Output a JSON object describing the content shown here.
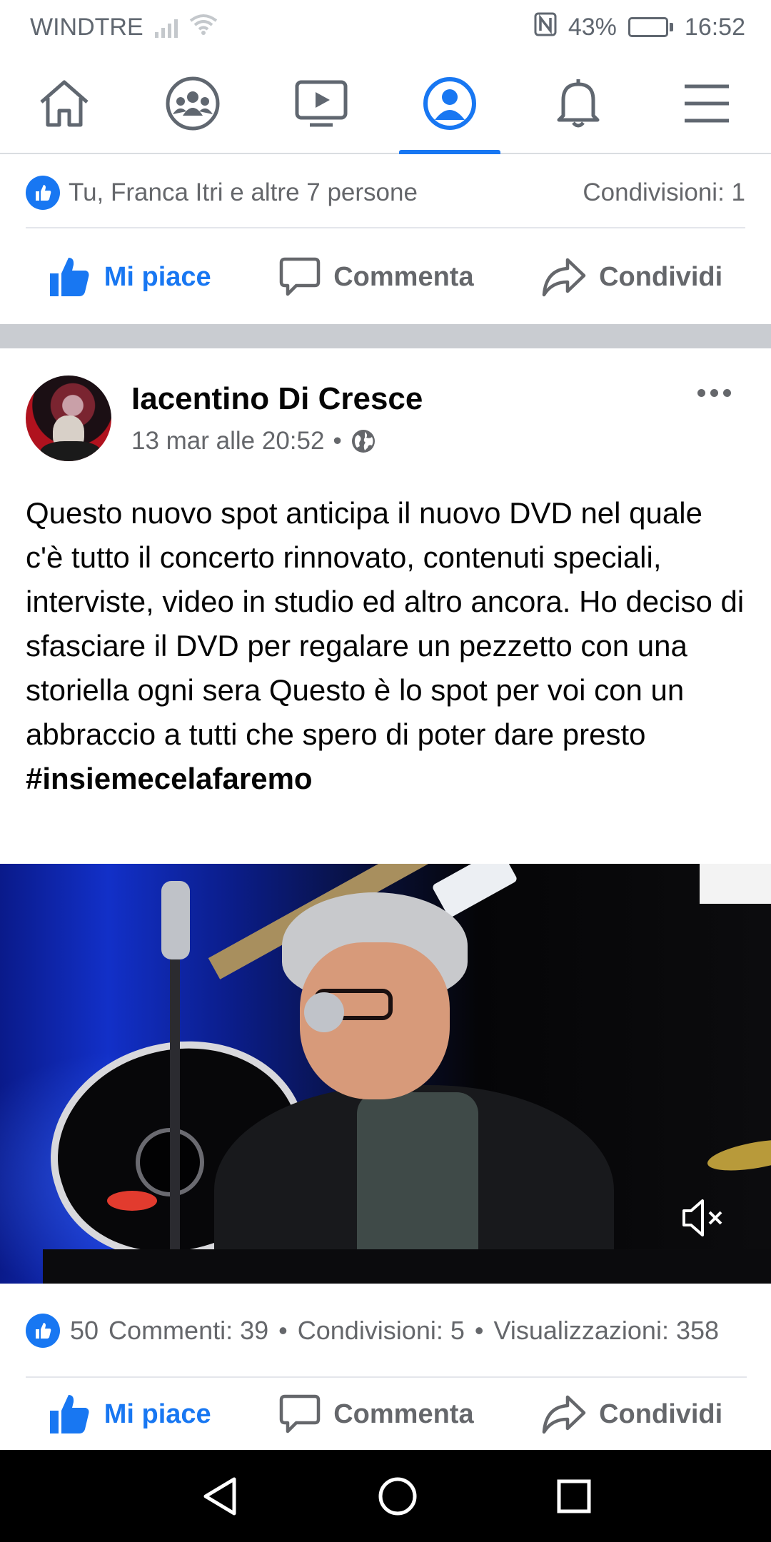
{
  "status_bar": {
    "carrier": "WINDTRE",
    "battery_percent": "43%",
    "battery_level": 0.43,
    "time": "16:52"
  },
  "nav": {
    "active": "profile",
    "items": [
      "home",
      "groups",
      "watch",
      "profile",
      "notifications",
      "menu"
    ]
  },
  "previous_post": {
    "reactions_text": "Tu, Franca Itri e altre 7 persone",
    "shares_text": "Condivisioni: 1",
    "like_label": "Mi piace",
    "comment_label": "Commenta",
    "share_label": "Condividi"
  },
  "post": {
    "author": "Iacentino Di Cresce",
    "timestamp": "13 mar alle 20:52",
    "separator": "•",
    "text": "Questo nuovo spot anticipa il nuovo DVD nel quale c'è tutto il concerto rinnovato, contenuti speciali, interviste, video in studio ed altro ancora. Ho deciso di sfasciare il DVD per regalare un pezzetto con una storiella ogni sera Questo è lo spot per voi con un abbraccio a tutti che spero di poter dare presto",
    "hashtag": "#insiemecelafaremo",
    "likes": "50",
    "comments": "Commenti: 39",
    "shares": "Condivisioni: 5",
    "views": "Visualizzazioni: 358",
    "dot": "•",
    "like_label": "Mi piace",
    "comment_label": "Commenta",
    "share_label": "Condividi"
  },
  "colors": {
    "accent": "#1877f2",
    "secondary_text": "#65676b",
    "separator": "#c9ccd1"
  }
}
